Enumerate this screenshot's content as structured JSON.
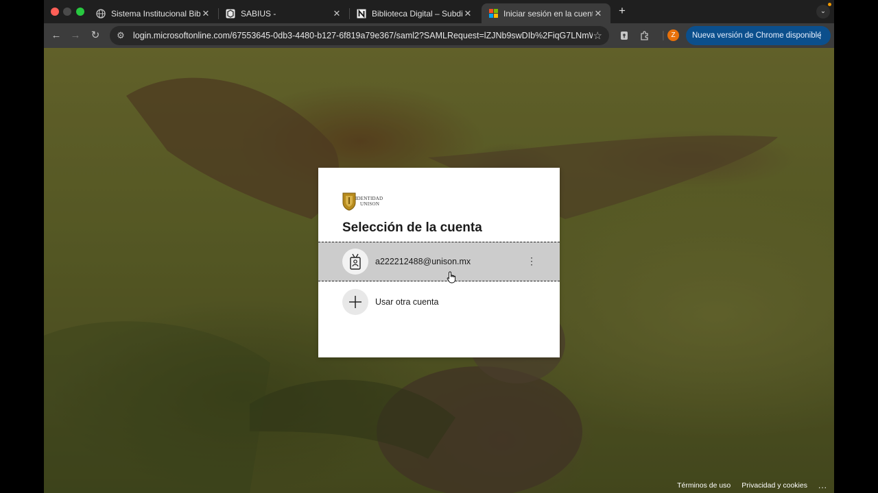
{
  "tabs": [
    {
      "title": "Sistema Institucional Biblioteca",
      "favicon": "globe-icon"
    },
    {
      "title": "SABIUS -",
      "favicon": "sabius-icon"
    },
    {
      "title": "Biblioteca Digital – Subdirección",
      "favicon": "n-logo-icon"
    },
    {
      "title": "Iniciar sesión en la cuenta",
      "favicon": "microsoft-icon",
      "active": true
    }
  ],
  "toolbar": {
    "url": "login.microsoftonline.com/67553645-0db3-4480-b127-6f819a79e367/saml2?SAMLRequest=lZJNb9swDIb%2FiqG7LNmW...",
    "profile_initial": "Z",
    "update_label": "Nueva versión de Chrome disponible"
  },
  "dialog": {
    "logo_line1": "IDENTIDAD",
    "logo_line2": "UNISON",
    "title": "Selección de la cuenta",
    "accounts": [
      {
        "label": "a222212488@unison.mx",
        "icon": "badge-icon"
      }
    ],
    "other_account_label": "Usar otra cuenta"
  },
  "footer": {
    "terms": "Términos de uso",
    "privacy": "Privacidad y cookies",
    "more": "..."
  },
  "colors": {
    "tab_bg": "#1f1f1f",
    "toolbar_bg": "#3c3c3c",
    "update_button": "#0b4f8c",
    "selected_account": "#cccccc"
  }
}
